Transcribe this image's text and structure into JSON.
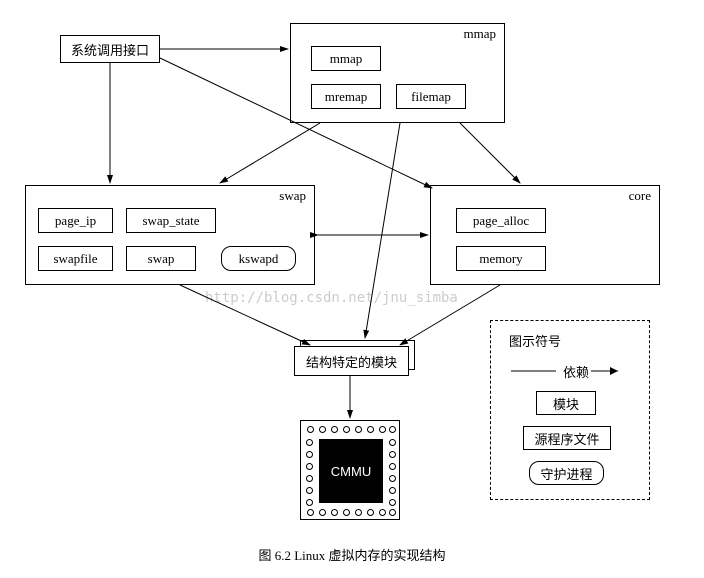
{
  "nodes": {
    "syscall": "系统调用接口",
    "mmap_group": "mmap",
    "mmap_inner_mmap": "mmap",
    "mmap_inner_mremap": "mremap",
    "mmap_inner_filemap": "filemap",
    "swap_group": "swap",
    "swap_page_ip": "page_ip",
    "swap_swap_state": "swap_state",
    "swap_swapfile": "swapfile",
    "swap_swap": "swap",
    "swap_kswapd": "kswapd",
    "core_group": "core",
    "core_page_alloc": "page_alloc",
    "core_memory": "memory",
    "arch_module": "结构特定的模块",
    "chip": "CMMU"
  },
  "legend": {
    "title": "图示符号",
    "depend": "依赖",
    "module": "模块",
    "source": "源程序文件",
    "daemon": "守护进程"
  },
  "watermark": "http://blog.csdn.net/jnu_simba",
  "caption": "图 6.2  Linux 虚拟内存的实现结构",
  "chart_data": {
    "type": "diagram",
    "title": "Linux 虚拟内存的实现结构",
    "nodes": [
      {
        "id": "syscall",
        "label": "系统调用接口",
        "kind": "module"
      },
      {
        "id": "mmap_group",
        "label": "mmap",
        "kind": "group",
        "children": [
          "mmap",
          "mremap",
          "filemap"
        ]
      },
      {
        "id": "swap_group",
        "label": "swap",
        "kind": "group",
        "children": [
          "page_ip",
          "swap_state",
          "swapfile",
          "swap",
          "kswapd"
        ]
      },
      {
        "id": "core_group",
        "label": "core",
        "kind": "group",
        "children": [
          "page_alloc",
          "memory"
        ]
      },
      {
        "id": "kswapd",
        "label": "kswapd",
        "kind": "daemon"
      },
      {
        "id": "arch_module",
        "label": "结构特定的模块",
        "kind": "module"
      },
      {
        "id": "cmmu",
        "label": "CMMU",
        "kind": "hardware"
      }
    ],
    "edges": [
      {
        "from": "syscall",
        "to": "mmap_group",
        "type": "depend"
      },
      {
        "from": "syscall",
        "to": "swap_group",
        "type": "depend"
      },
      {
        "from": "syscall",
        "to": "core_group",
        "type": "depend"
      },
      {
        "from": "mmap_group",
        "to": "swap_group",
        "type": "depend"
      },
      {
        "from": "mmap_group",
        "to": "core_group",
        "type": "depend"
      },
      {
        "from": "swap_group",
        "to": "core_group",
        "type": "bidirectional"
      },
      {
        "from": "mmap_group",
        "to": "arch_module",
        "type": "depend"
      },
      {
        "from": "swap_group",
        "to": "arch_module",
        "type": "depend"
      },
      {
        "from": "core_group",
        "to": "arch_module",
        "type": "depend"
      },
      {
        "from": "arch_module",
        "to": "cmmu",
        "type": "depend"
      }
    ],
    "legend": {
      "depend": "依赖",
      "module": "模块",
      "source": "源程序文件",
      "daemon": "守护进程"
    }
  }
}
